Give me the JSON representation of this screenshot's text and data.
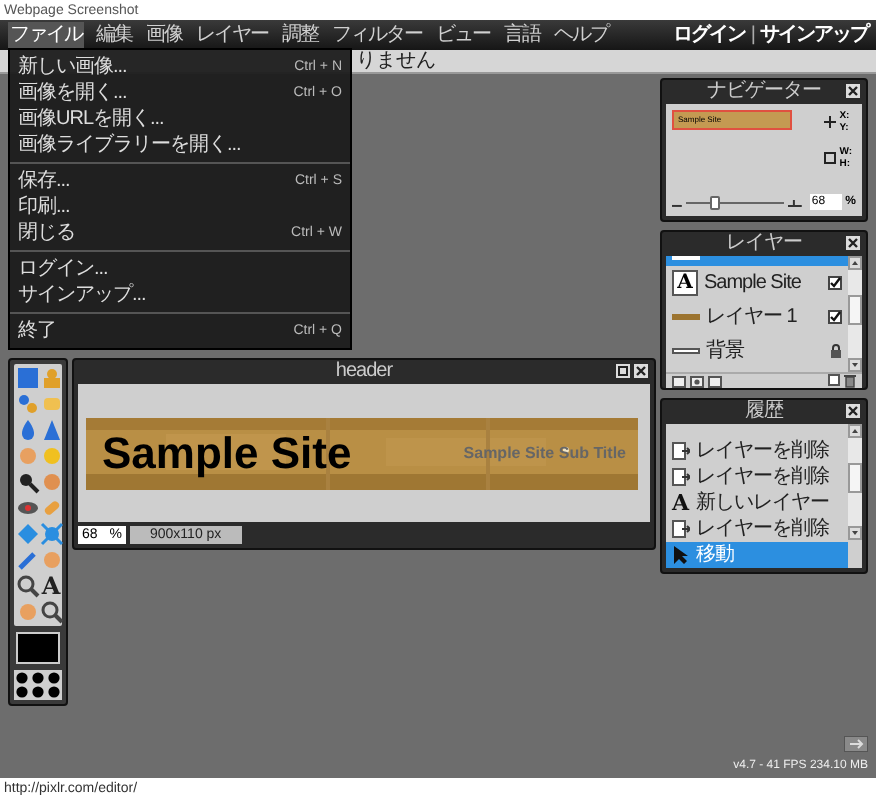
{
  "page_title": "Webpage Screenshot",
  "menu": [
    {
      "label": "ファイル",
      "selected": true
    },
    {
      "label": "編集",
      "selected": false
    },
    {
      "label": "画像",
      "selected": false
    },
    {
      "label": "レイヤー",
      "selected": false
    },
    {
      "label": "調整",
      "selected": false
    },
    {
      "label": "フィルター",
      "selected": false
    },
    {
      "label": "ビュー",
      "selected": false
    },
    {
      "label": "言語",
      "selected": false
    },
    {
      "label": "ヘルプ",
      "selected": false
    }
  ],
  "account": {
    "login": "ログイン",
    "separator": "|",
    "signup": "サインアップ"
  },
  "options_bar": {
    "message": "りません"
  },
  "file_menu": [
    {
      "kind": "item",
      "label": "新しい画像...",
      "shortcut": "Ctrl + N"
    },
    {
      "kind": "item",
      "label": "画像を開く...",
      "shortcut": "Ctrl + O"
    },
    {
      "kind": "item",
      "label": "画像URLを開く..."
    },
    {
      "kind": "item",
      "label": "画像ライブラリーを開く..."
    },
    {
      "kind": "separator"
    },
    {
      "kind": "item",
      "label": "保存...",
      "shortcut": "Ctrl + S"
    },
    {
      "kind": "item",
      "label": "印刷..."
    },
    {
      "kind": "item",
      "label": "閉じる",
      "shortcut": "Ctrl + W"
    },
    {
      "kind": "separator"
    },
    {
      "kind": "item",
      "label": "ログイン..."
    },
    {
      "kind": "item",
      "label": "サインアップ..."
    },
    {
      "kind": "separator"
    },
    {
      "kind": "item",
      "label": "終了",
      "shortcut": "Ctrl + Q"
    }
  ],
  "tools": [
    {
      "kind": "icon"
    },
    {
      "kind": "icon"
    },
    {
      "kind": "icon"
    },
    {
      "kind": "icon"
    },
    {
      "kind": "icon"
    },
    {
      "kind": "icon"
    },
    {
      "kind": "icon"
    },
    {
      "kind": "icon"
    },
    {
      "kind": "icon"
    },
    {
      "kind": "icon"
    },
    {
      "kind": "icon"
    },
    {
      "kind": "icon"
    },
    {
      "kind": "icon"
    },
    {
      "kind": "icon"
    },
    {
      "kind": "icon"
    },
    {
      "kind": "icon"
    },
    {
      "kind": "icon"
    },
    {
      "kind": "glyph",
      "text": "A"
    },
    {
      "kind": "icon"
    },
    {
      "kind": "icon"
    }
  ],
  "document": {
    "title": "header",
    "heading": "Sample Site",
    "subtitle": "Sample Site Sub Title",
    "zoom": "68",
    "zoom_unit": "%",
    "size": "900x110 px"
  },
  "navigator": {
    "title": "ナビゲーター",
    "thumb_text": "Sample Site",
    "x_label": "X:",
    "y_label": "Y:",
    "w_label": "W:",
    "h_label": "H:",
    "zoom": {
      "level": 0.3
    },
    "zoom_value": "68",
    "zoom_unit": "%"
  },
  "layers": {
    "title": "レイヤー",
    "items": [
      {
        "kind": "partial",
        "selected": true
      },
      {
        "kind": "text",
        "thumb": "A",
        "name": "Sample Site",
        "checked": true,
        "selected": false
      },
      {
        "name": "レイヤー 1",
        "checked": true,
        "selected": false
      },
      {
        "kind": "background",
        "name": "背景",
        "locked": true,
        "selected": false
      }
    ]
  },
  "history": {
    "title": "履歴",
    "items": [
      {
        "kind": "delete",
        "label": "レイヤーを削除",
        "selected": false
      },
      {
        "kind": "delete",
        "label": "レイヤーを削除",
        "selected": false
      },
      {
        "kind": "new",
        "glyph": "A",
        "label": "新しいレイヤー",
        "selected": false
      },
      {
        "kind": "delete",
        "label": "レイヤーを削除",
        "selected": false
      },
      {
        "kind": "move",
        "label": "移動",
        "selected": true
      }
    ]
  },
  "version": "v4.7 - 41 FPS 234.10 MB",
  "status_url": "http://pixlr.com/editor/"
}
